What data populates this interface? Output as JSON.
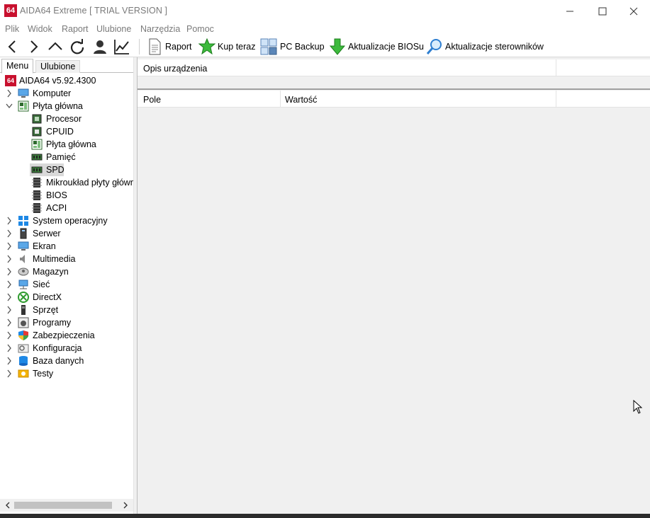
{
  "window": {
    "logo_text": "64",
    "title": "AIDA64 Extreme  [ TRIAL VERSION ]"
  },
  "menu": {
    "items": [
      "Plik",
      "Widok",
      "Raport",
      "Ulubione",
      "Narzędzia",
      "Pomoc"
    ]
  },
  "toolbar": {
    "buttons": [
      {
        "label": "Raport",
        "icon": "report-icon"
      },
      {
        "label": "Kup teraz",
        "icon": "buy-now-icon"
      },
      {
        "label": "PC Backup",
        "icon": "pc-backup-icon"
      },
      {
        "label": "Aktualizacje BIOSu",
        "icon": "bios-update-icon"
      },
      {
        "label": "Aktualizacje sterowników",
        "icon": "driver-update-icon"
      }
    ],
    "nav_icons": [
      "back-icon",
      "forward-icon",
      "up-icon",
      "refresh-icon",
      "user-icon",
      "chart-icon"
    ]
  },
  "sidebar": {
    "tabs": [
      "Menu",
      "Ulubione"
    ],
    "active_tab": "Menu",
    "root": {
      "label": "AIDA64 v5.92.4300",
      "logo_text": "64"
    },
    "tree": [
      {
        "label": "Komputer",
        "icon": "computer-icon",
        "expanded": false
      },
      {
        "label": "Płyta główna",
        "icon": "motherboard-icon",
        "expanded": true
      },
      {
        "label": "Procesor",
        "icon": "cpu-icon",
        "child": true
      },
      {
        "label": "CPUID",
        "icon": "cpuid-icon",
        "child": true
      },
      {
        "label": "Płyta główna",
        "icon": "motherboard-icon",
        "child": true
      },
      {
        "label": "Pamięć",
        "icon": "memory-icon",
        "child": true
      },
      {
        "label": "SPD",
        "icon": "spd-icon",
        "child": true,
        "selected": true
      },
      {
        "label": "Mikroukład płyty główn",
        "icon": "chipset-icon",
        "child": true
      },
      {
        "label": "BIOS",
        "icon": "bios-icon",
        "child": true
      },
      {
        "label": "ACPI",
        "icon": "acpi-icon",
        "child": true
      },
      {
        "label": "System operacyjny",
        "icon": "windows-icon",
        "expanded": false
      },
      {
        "label": "Serwer",
        "icon": "server-icon",
        "expanded": false
      },
      {
        "label": "Ekran",
        "icon": "display-icon",
        "expanded": false
      },
      {
        "label": "Multimedia",
        "icon": "speaker-icon",
        "expanded": false
      },
      {
        "label": "Magazyn",
        "icon": "storage-icon",
        "expanded": false
      },
      {
        "label": "Sieć",
        "icon": "network-icon",
        "expanded": false
      },
      {
        "label": "DirectX",
        "icon": "directx-icon",
        "expanded": false
      },
      {
        "label": "Sprzęt",
        "icon": "devices-icon",
        "expanded": false
      },
      {
        "label": "Programy",
        "icon": "software-icon",
        "expanded": false
      },
      {
        "label": "Zabezpieczenia",
        "icon": "security-shield-icon",
        "expanded": false
      },
      {
        "label": "Konfiguracja",
        "icon": "config-icon",
        "expanded": false
      },
      {
        "label": "Baza danych",
        "icon": "database-icon",
        "expanded": false
      },
      {
        "label": "Testy",
        "icon": "benchmark-icon",
        "expanded": false
      }
    ]
  },
  "main": {
    "description_header": "Opis urządzenia",
    "columns": [
      "Pole",
      "Wartość"
    ]
  },
  "colors": {
    "accent": "#c8102e",
    "selection": "#d9d9d9",
    "panel_bg": "#f0f0f0"
  }
}
